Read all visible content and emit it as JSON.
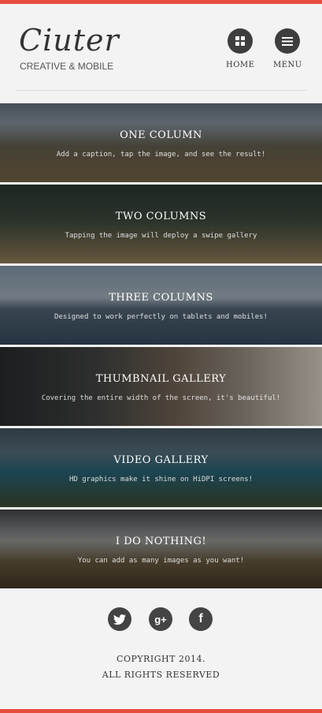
{
  "header": {
    "logo": "Ciuter",
    "tagline": "CREATIVE & MOBILE",
    "nav": [
      {
        "label": "HOME",
        "icon": "grid-icon"
      },
      {
        "label": "MENU",
        "icon": "hamburger-icon"
      }
    ]
  },
  "panels": [
    {
      "title": "ONE COLUMN",
      "caption": "Add a caption, tap the image, and see the result!"
    },
    {
      "title": "TWO COLUMNS",
      "caption": "Tapping the image will deploy a swipe gallery"
    },
    {
      "title": "THREE COLUMNS",
      "caption": "Designed to work perfectly on tablets and mobiles!"
    },
    {
      "title": "THUMBNAIL GALLERY",
      "caption": "Covering the entire width of the screen, it's beautiful!"
    },
    {
      "title": "VIDEO GALLERY",
      "caption": "HD graphics make it shine on HiDPI screens!"
    },
    {
      "title": "I DO NOTHING!",
      "caption": "You can add as many images as you want!"
    }
  ],
  "footer": {
    "social": [
      {
        "icon": "twitter-icon"
      },
      {
        "icon": "google-plus-icon"
      },
      {
        "icon": "facebook-icon"
      }
    ],
    "copyright_line1": "COPYRIGHT 2014.",
    "copyright_line2": "ALL RIGHTS RESERVED"
  },
  "colors": {
    "accent": "#e74c3c",
    "dark": "#3e3e3e",
    "background": "#f3f3f3"
  }
}
